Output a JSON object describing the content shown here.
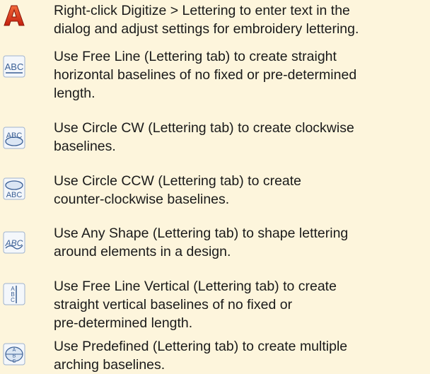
{
  "tips": [
    {
      "icon": "lettering-a-icon",
      "lines": [
        "Right-click Digitize > Lettering to enter text in the",
        "dialog and adjust settings for embroidery lettering."
      ]
    },
    {
      "icon": "free-line-icon",
      "icon_text": "ABC",
      "lines": [
        "Use Free Line (Lettering tab) to create straight",
        "horizontal baselines of no fixed or pre-determined",
        "length."
      ]
    },
    {
      "icon": "circle-cw-icon",
      "icon_text": "ABC",
      "lines": [
        "Use Circle CW (Lettering tab) to create clockwise",
        "baselines."
      ]
    },
    {
      "icon": "circle-ccw-icon",
      "icon_text": "ABC",
      "lines": [
        "Use Circle CCW (Lettering tab) to create",
        "counter-clockwise baselines."
      ]
    },
    {
      "icon": "any-shape-icon",
      "icon_text": "ABC",
      "lines": [
        "Use Any Shape (Lettering tab) to shape lettering",
        "around elements in a design."
      ]
    },
    {
      "icon": "free-line-vertical-icon",
      "icon_text": "ABC",
      "lines": [
        "Use Free Line Vertical (Lettering tab) to create",
        "straight vertical baselines of no fixed or",
        "pre-determined length."
      ]
    },
    {
      "icon": "predefined-icon",
      "icon_text": "ABC",
      "lines": [
        "Use Predefined (Lettering tab) to create multiple",
        "arching baselines."
      ]
    }
  ],
  "colors": {
    "background": "#fdf5dc",
    "lettering_icon_red": "#d8281a",
    "icon_blue": "#4a6fa8",
    "icon_fill": "#dbe6f4",
    "text": "#1a1a1a"
  }
}
